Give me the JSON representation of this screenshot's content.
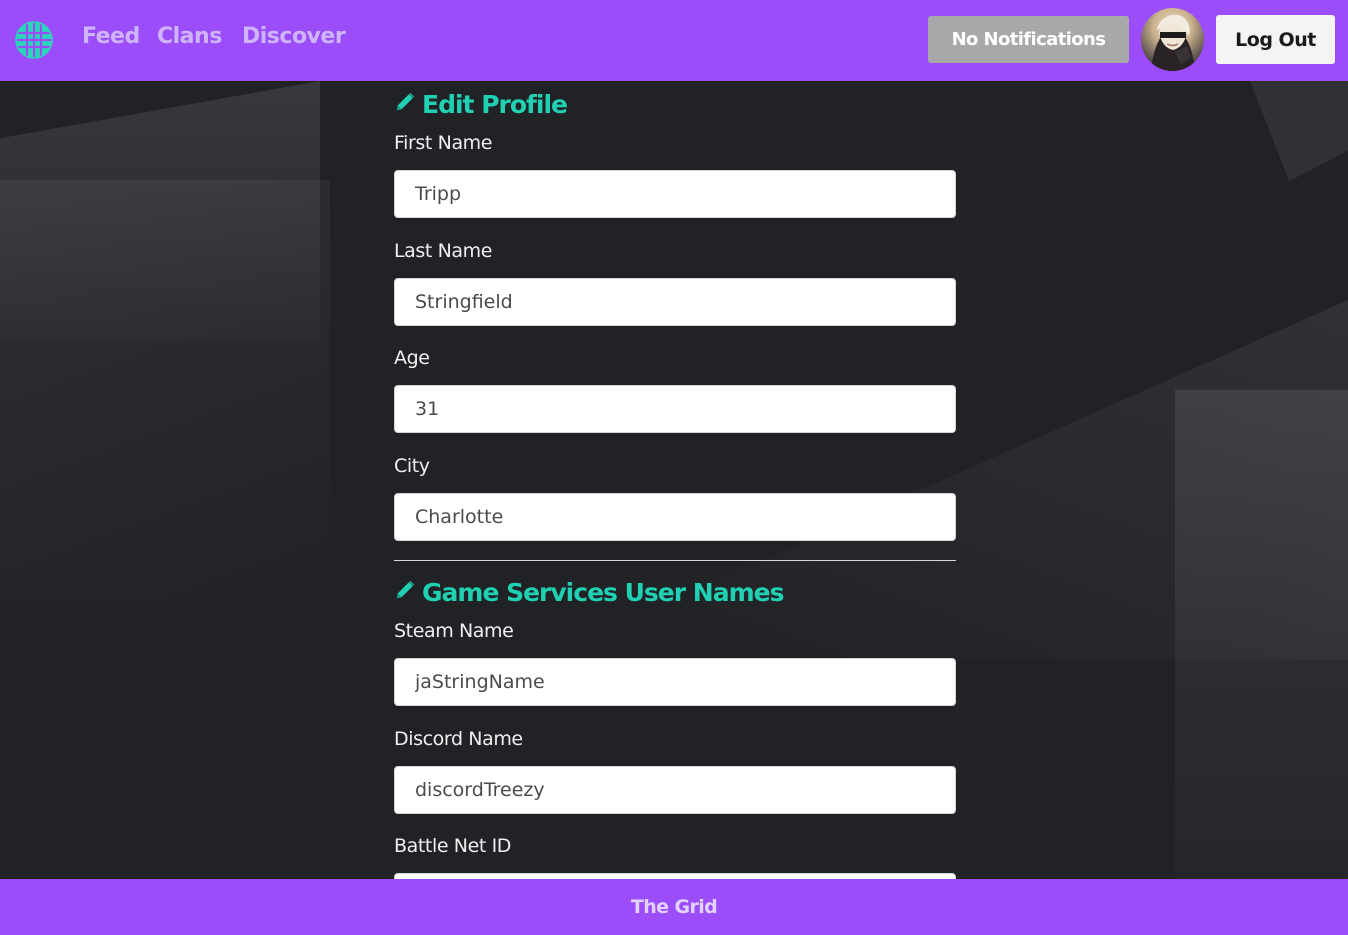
{
  "header": {
    "nav": {
      "feed": "Feed",
      "clans": "Clans",
      "discover": "Discover"
    },
    "notifications_label": "No Notifications",
    "logout_label": "Log Out",
    "logo_icon": "globe-grid-icon",
    "avatar_icon": "user-avatar"
  },
  "edit_profile": {
    "title": "Edit Profile",
    "icon": "pencil-icon",
    "fields": {
      "first_name": {
        "label": "First Name",
        "value": "Tripp"
      },
      "last_name": {
        "label": "Last Name",
        "value": "Stringfield"
      },
      "age": {
        "label": "Age",
        "value": "31"
      },
      "city": {
        "label": "City",
        "value": "Charlotte"
      }
    }
  },
  "game_services": {
    "title": "Game Services User Names",
    "icon": "pencil-icon",
    "fields": {
      "steam": {
        "label": "Steam Name",
        "value": "jaStringName"
      },
      "discord": {
        "label": "Discord Name",
        "value": "discordTreezy"
      },
      "battle_net": {
        "label": "Battle Net ID",
        "value": ""
      }
    }
  },
  "footer": {
    "text": "The Grid"
  },
  "colors": {
    "brand_purple": "#9b4dfa",
    "accent_teal": "#1fd1b2",
    "background": "#212226"
  }
}
